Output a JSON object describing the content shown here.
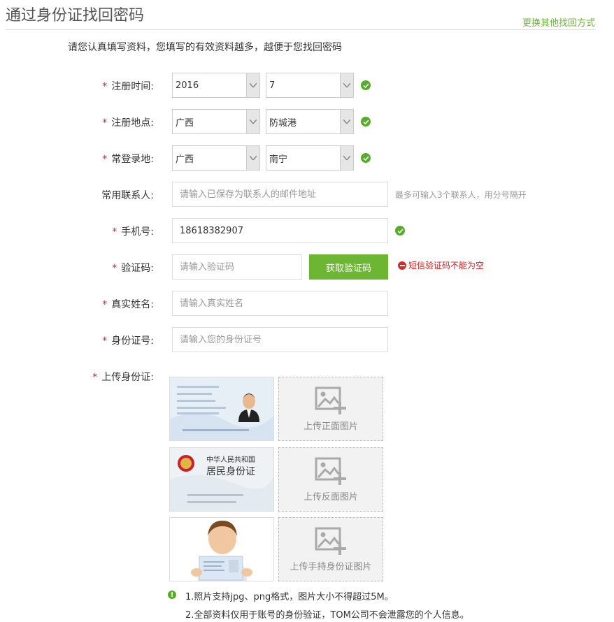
{
  "header": {
    "title": "通过身份证找回密码",
    "switch_link": "更换其他找回方式"
  },
  "intro": "请您认真填写资料，您填写的有效资料越多，越便于您找回密码",
  "form": {
    "reg_time": {
      "label": "注册时间:",
      "year": "2016",
      "month": "7"
    },
    "reg_place": {
      "label": "注册地点:",
      "province": "广西",
      "city": "防城港"
    },
    "login_place": {
      "label": "常登录地:",
      "province": "广西",
      "city": "南宁"
    },
    "contacts": {
      "label": "常用联系人:",
      "placeholder": "请输入已保存为联系人的邮件地址",
      "hint": "最多可输入3个联系人，用分号隔开"
    },
    "phone": {
      "label": "手机号:",
      "value": "18618382907"
    },
    "code": {
      "label": "验证码:",
      "placeholder": "请输入验证码",
      "button": "获取验证码",
      "error": "短信验证码不能为空"
    },
    "real_name": {
      "label": "真实姓名:",
      "placeholder": "请输入真实姓名"
    },
    "id_number": {
      "label": "身份证号:",
      "placeholder": "请输入您的身份证号"
    },
    "upload": {
      "label": "上传身份证:",
      "front": "上传正面图片",
      "back": "上传反面图片",
      "hold": "上传手持身份证图片",
      "sample_back_title1": "中华人民共和国",
      "sample_back_title2": "居民身份证"
    }
  },
  "notes": {
    "line1": "1.照片支持jpg、png格式，图片大小不得超过5M。",
    "line2": "2.全部资料仅用于账号的身份验证，TOM公司不会泄露您的个人信息。"
  },
  "colors": {
    "accent": "#6cb633",
    "error": "#d01f1f",
    "required": "#e02020"
  }
}
